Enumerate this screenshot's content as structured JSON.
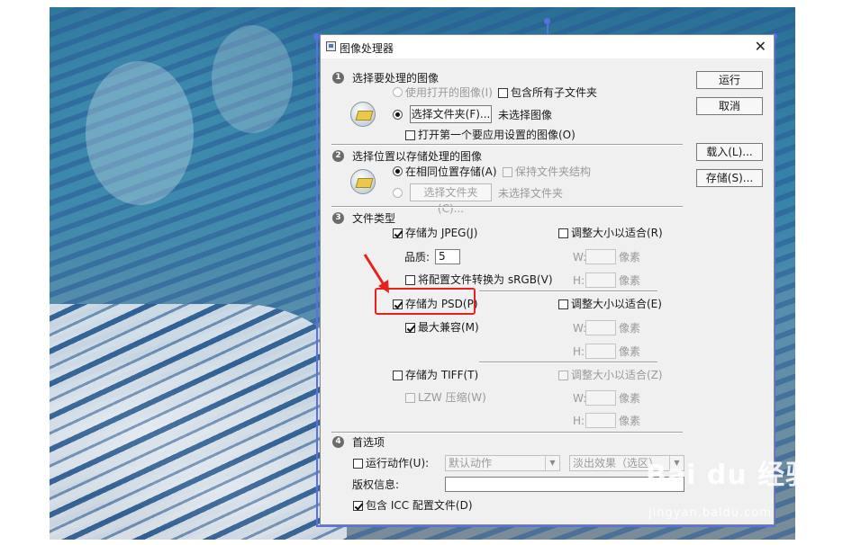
{
  "dialog": {
    "title": "图像处理器",
    "close_symbol": "✕",
    "buttons": {
      "run": "运行",
      "cancel": "取消",
      "load": "载入(L)...",
      "save": "存储(S)..."
    },
    "section1": {
      "number": "1",
      "heading": "选择要处理的图像",
      "use_open_images": "使用打开的图像(I)",
      "include_subfolders": "包含所有子文件夹",
      "select_folder_button": "选择文件夹(F)...",
      "no_images_selected": "未选择图像",
      "open_first_image": "打开第一个要应用设置的图像(O)"
    },
    "section2": {
      "number": "2",
      "heading": "选择位置以存储处理的图像",
      "save_same_location": "在相同位置存储(A)",
      "keep_folder_structure": "保持文件夹结构",
      "select_folder_button": "选择文件夹(C)...",
      "no_folder_selected": "未选择文件夹"
    },
    "section3": {
      "number": "3",
      "heading": "文件类型",
      "jpeg": {
        "save_label": "存储为 JPEG(J)",
        "checked": true,
        "resize_label": "调整大小以适合(R)",
        "quality_label": "品质:",
        "quality_value": "5",
        "w_label": "W:",
        "h_label": "H:",
        "unit": "像素",
        "convert_srgb": "将配置文件转换为 sRGB(V)"
      },
      "psd": {
        "save_label": "存储为 PSD(P)",
        "checked": true,
        "resize_label": "调整大小以适合(E)",
        "max_compat": "最大兼容(M)",
        "w_label": "W:",
        "h_label": "H:",
        "unit": "像素"
      },
      "tiff": {
        "save_label": "存储为 TIFF(T)",
        "checked": false,
        "resize_label": "调整大小以适合(Z)",
        "lzw": "LZW 压缩(W)",
        "w_label": "W:",
        "h_label": "H:",
        "unit": "像素"
      }
    },
    "section4": {
      "number": "4",
      "heading": "首选项",
      "run_action": "运行动作(U):",
      "action_set": "默认动作",
      "action": "淡出效果（选区）",
      "copyright_label": "版权信息:",
      "copyright_value": "",
      "include_icc": "包含 ICC 配置文件(D)"
    }
  },
  "watermark": {
    "brand": "Bai du 经验",
    "url": "jingyan.baidu.com"
  },
  "colors": {
    "highlight_box": "#e8211c",
    "selection_outline": "#5a6fe0"
  }
}
